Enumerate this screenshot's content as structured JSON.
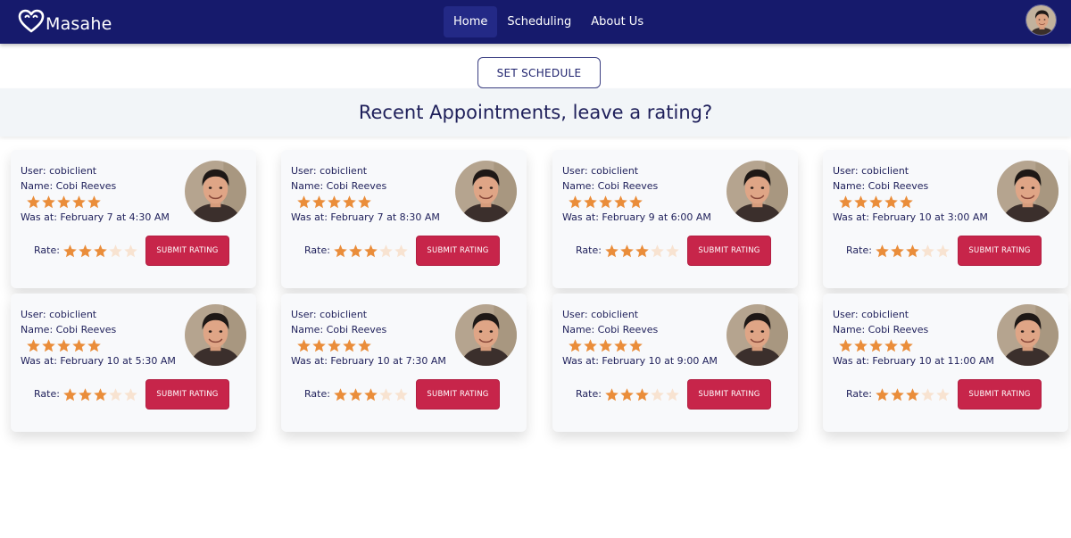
{
  "brand": {
    "name": "Masahe"
  },
  "nav": {
    "items": [
      "Home",
      "Scheduling",
      "About Us"
    ],
    "active": "Home"
  },
  "actions": {
    "set_schedule": "SET SCHEDULE"
  },
  "banner": {
    "title": "Recent Appointments, leave a rating?"
  },
  "colors": {
    "navbar": "#161a6c",
    "accent": "#c7254a",
    "star_filled": "#ea8d3a",
    "star_empty": "#f8e3d1"
  },
  "appointments": [
    {
      "user": "User: cobiclient",
      "name": "Name: Cobi Reeves",
      "therapist_rating": 5,
      "time": "Was at: February 7 at 4:30 AM",
      "rate_label": "Rate:",
      "user_rating": 3,
      "submit_label": "SUBMIT RATING"
    },
    {
      "user": "User: cobiclient",
      "name": "Name: Cobi Reeves",
      "therapist_rating": 5,
      "time": "Was at: February 7 at 8:30 AM",
      "rate_label": "Rate:",
      "user_rating": 3,
      "submit_label": "SUBMIT RATING"
    },
    {
      "user": "User: cobiclient",
      "name": "Name: Cobi Reeves",
      "therapist_rating": 5,
      "time": "Was at: February 9 at 6:00 AM",
      "rate_label": "Rate:",
      "user_rating": 3,
      "submit_label": "SUBMIT RATING"
    },
    {
      "user": "User: cobiclient",
      "name": "Name: Cobi Reeves",
      "therapist_rating": 5,
      "time": "Was at: February 10 at 3:00 AM",
      "rate_label": "Rate:",
      "user_rating": 3,
      "submit_label": "SUBMIT RATING"
    },
    {
      "user": "User: cobiclient",
      "name": "Name: Cobi Reeves",
      "therapist_rating": 5,
      "time": "Was at: February 10 at 5:30 AM",
      "rate_label": "Rate:",
      "user_rating": 3,
      "submit_label": "SUBMIT RATING"
    },
    {
      "user": "User: cobiclient",
      "name": "Name: Cobi Reeves",
      "therapist_rating": 5,
      "time": "Was at: February 10 at 7:30 AM",
      "rate_label": "Rate:",
      "user_rating": 3,
      "submit_label": "SUBMIT RATING"
    },
    {
      "user": "User: cobiclient",
      "name": "Name: Cobi Reeves",
      "therapist_rating": 5,
      "time": "Was at: February 10 at 9:00 AM",
      "rate_label": "Rate:",
      "user_rating": 3,
      "submit_label": "SUBMIT RATING"
    },
    {
      "user": "User: cobiclient",
      "name": "Name: Cobi Reeves",
      "therapist_rating": 5,
      "time": "Was at: February 10 at 11:00 AM",
      "rate_label": "Rate:",
      "user_rating": 3,
      "submit_label": "SUBMIT RATING"
    }
  ]
}
